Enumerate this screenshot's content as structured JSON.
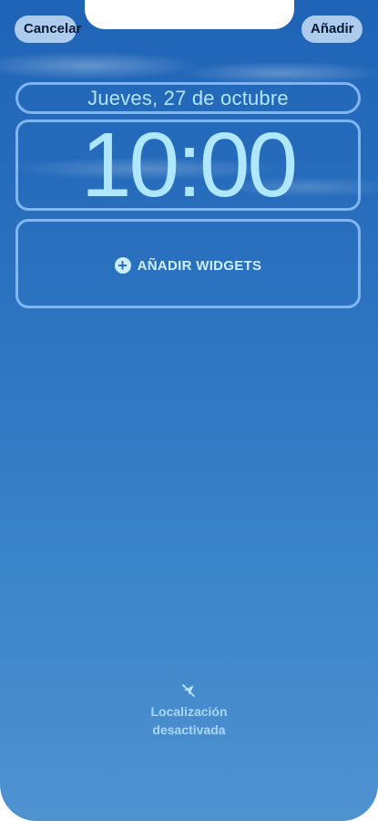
{
  "top_bar": {
    "cancel_label": "Cancelar",
    "add_label": "Añadir"
  },
  "lock_screen": {
    "date": "Jueves, 27 de octubre",
    "time": "10:00",
    "widgets_label": "AÑADIR WIDGETS"
  },
  "status": {
    "location_line_1": "Localización",
    "location_line_2": "desactivada",
    "location_icon": "location-off-icon"
  },
  "colors": {
    "background_top": "#1f63b6",
    "background_bottom": "#4f92d0",
    "button_background": "#b5d2ef",
    "accent_text": "#aee7ff"
  }
}
